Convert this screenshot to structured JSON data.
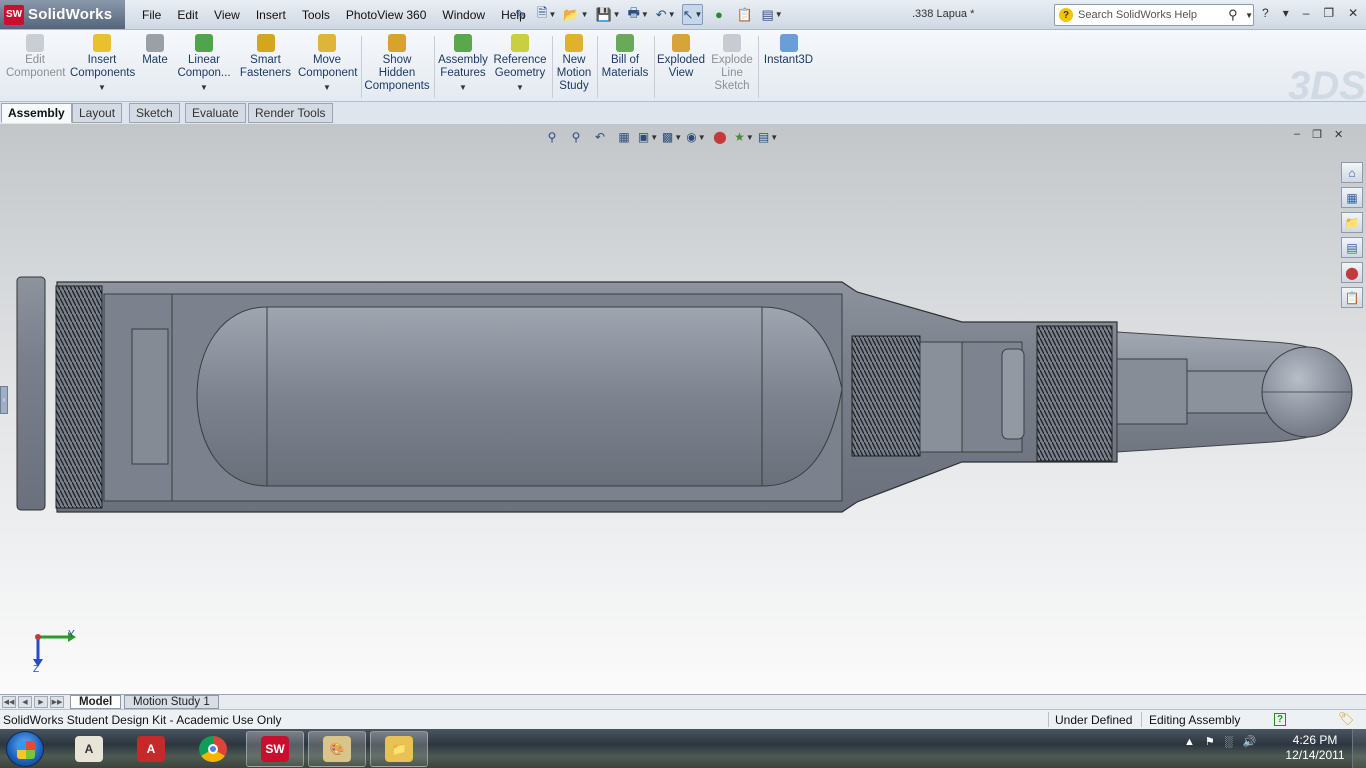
{
  "app": {
    "brand": "SolidWorks",
    "badge": "SW",
    "document_title": ".338 Lapua *"
  },
  "menu": [
    "File",
    "Edit",
    "View",
    "Insert",
    "Tools",
    "PhotoView 360",
    "Window",
    "Help"
  ],
  "help_search": {
    "placeholder": "Search SolidWorks Help",
    "help_label": "?"
  },
  "command_manager": [
    {
      "id": "edit-component",
      "label": [
        "Edit",
        "Component"
      ],
      "disabled": true
    },
    {
      "id": "insert-components",
      "label": [
        "Insert",
        "Components"
      ],
      "dropdown": true
    },
    {
      "id": "mate",
      "label": [
        "Mate"
      ]
    },
    {
      "id": "linear-component",
      "label": [
        "Linear",
        "Compon..."
      ],
      "dropdown": true
    },
    {
      "id": "smart-fasteners",
      "label": [
        "Smart",
        "Fasteners"
      ]
    },
    {
      "id": "move-component",
      "label": [
        "Move",
        "Component"
      ],
      "dropdown": true
    },
    {
      "id": "show-hidden-components",
      "label": [
        "Show",
        "Hidden",
        "Components"
      ]
    },
    {
      "id": "assembly-features",
      "label": [
        "Assembly",
        "Features"
      ],
      "dropdown": true
    },
    {
      "id": "reference-geometry",
      "label": [
        "Reference",
        "Geometry"
      ],
      "dropdown": true
    },
    {
      "id": "new-motion-study",
      "label": [
        "New",
        "Motion",
        "Study"
      ]
    },
    {
      "id": "bill-of-materials",
      "label": [
        "Bill of",
        "Materials"
      ]
    },
    {
      "id": "exploded-view",
      "label": [
        "Exploded",
        "View"
      ]
    },
    {
      "id": "explode-line-sketch",
      "label": [
        "Explode",
        "Line",
        "Sketch"
      ],
      "disabled": true
    },
    {
      "id": "instant3d",
      "label": [
        "Instant3D"
      ]
    }
  ],
  "cm_tabs": [
    "Assembly",
    "Layout",
    "Sketch",
    "Evaluate",
    "Render Tools"
  ],
  "active_cm_tab": "Assembly",
  "triad": {
    "y": "Y",
    "z": "Z"
  },
  "bottom_tabs": [
    "Model",
    "Motion Study 1"
  ],
  "active_bottom_tab": "Model",
  "status": {
    "left": "SolidWorks Student Design Kit - Academic Use Only",
    "definition": "Under Defined",
    "mode": "Editing Assembly",
    "help_label": "?"
  },
  "taskbar": {
    "apps": [
      "AutoCAD",
      "Autodesk Inventor",
      "Google Chrome",
      "SolidWorks",
      "Paint",
      "Windows Explorer"
    ],
    "time": "4:26 PM",
    "date": "12/14/2011"
  },
  "colors": {
    "model_gray": "#7d838f",
    "brand_red": "#c8102e",
    "accent_blue": "#2c5fa0"
  }
}
